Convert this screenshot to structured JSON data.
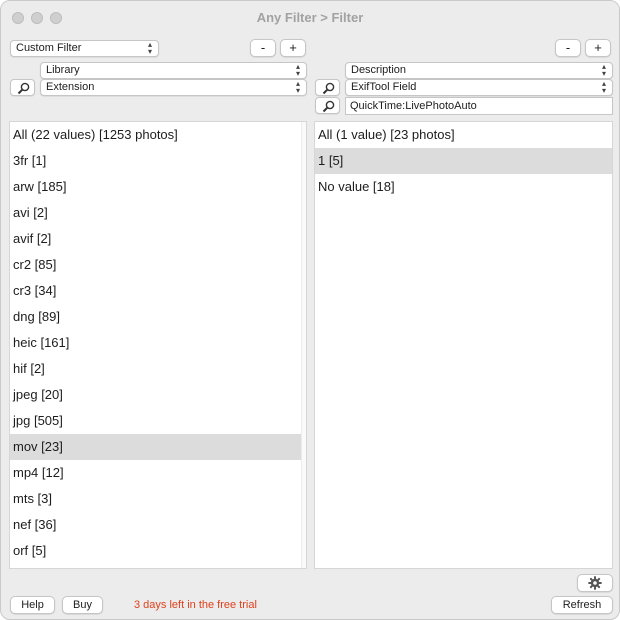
{
  "window": {
    "title": "Any Filter > Filter"
  },
  "left": {
    "filter_select": "Custom Filter",
    "minus_label": "-",
    "plus_label": "+",
    "source_select": "Library",
    "field_select": "Extension",
    "rows": [
      {
        "label": "All (22 values) [1253 photos]",
        "selected": false
      },
      {
        "label": "3fr [1]",
        "selected": false
      },
      {
        "label": "arw [185]",
        "selected": false
      },
      {
        "label": "avi [2]",
        "selected": false
      },
      {
        "label": "avif [2]",
        "selected": false
      },
      {
        "label": "cr2 [85]",
        "selected": false
      },
      {
        "label": "cr3 [34]",
        "selected": false
      },
      {
        "label": "dng [89]",
        "selected": false
      },
      {
        "label": "heic [161]",
        "selected": false
      },
      {
        "label": "hif [2]",
        "selected": false
      },
      {
        "label": "jpeg [20]",
        "selected": false
      },
      {
        "label": "jpg [505]",
        "selected": false
      },
      {
        "label": "mov [23]",
        "selected": true
      },
      {
        "label": "mp4 [12]",
        "selected": false
      },
      {
        "label": "mts [3]",
        "selected": false
      },
      {
        "label": "nef [36]",
        "selected": false
      },
      {
        "label": "orf [5]",
        "selected": false
      }
    ]
  },
  "right": {
    "minus_label": "-",
    "plus_label": "+",
    "source_select": "Description",
    "field_select": "ExifTool Field",
    "tag_field_value": "QuickTime:LivePhotoAuto",
    "rows": [
      {
        "label": "All (1 value) [23 photos]",
        "selected": false
      },
      {
        "label": "1 [5]",
        "selected": true
      },
      {
        "label": "No value [18]",
        "selected": false
      }
    ]
  },
  "footer": {
    "help_label": "Help",
    "buy_label": "Buy",
    "trial_text": "3 days left in the free trial",
    "refresh_label": "Refresh",
    "settings_icon": "gear-icon"
  },
  "colors": {
    "trial_text": "#e0401b",
    "selection": "#dcdcdc",
    "window_bg": "#ececec"
  }
}
